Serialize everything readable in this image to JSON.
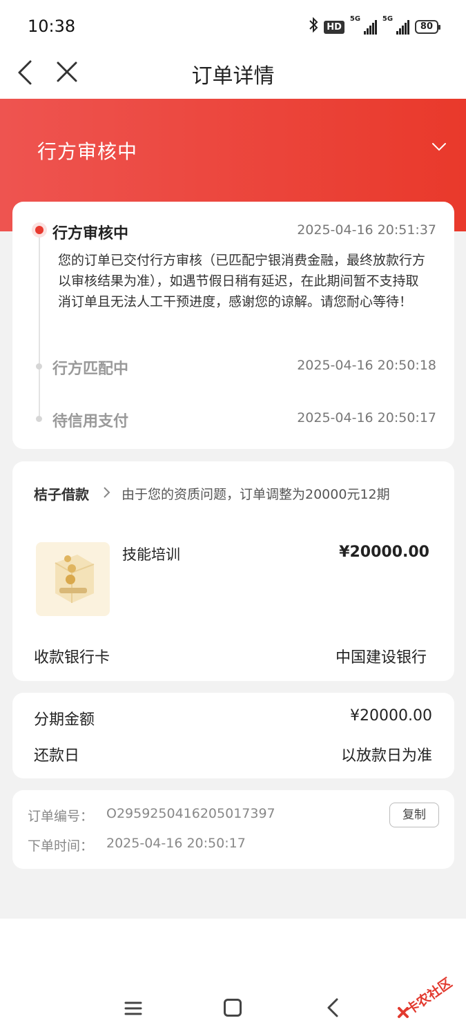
{
  "status_bar": {
    "time": "10:38",
    "hd_label": "HD",
    "signal1_label": "5G",
    "signal2_label": "5G",
    "battery": "80",
    "icons": [
      "bluetooth-icon",
      "hd-voice-icon",
      "signal-icon",
      "signal-icon",
      "battery-icon"
    ]
  },
  "nav": {
    "title": "订单详情",
    "icons": [
      "back-icon",
      "close-icon"
    ]
  },
  "banner": {
    "status": "行方审核中",
    "icon": "chevron-down-icon",
    "colors": [
      "#ee5450",
      "#e9392b"
    ]
  },
  "timeline": [
    {
      "title": "行方审核中",
      "time": "2025-04-16 20:51:37",
      "desc": "您的订单已交付行方审核（已匹配宁银消费金融，最终放款行方以审核结果为准），如遇节假日稍有延迟，在此期间暂不支持取消订单且无法人工干预进度，感谢您的谅解。请您耐心等待！",
      "active": true
    },
    {
      "title": "行方匹配中",
      "time": "2025-04-16 20:50:18",
      "active": false
    },
    {
      "title": "待信用支付",
      "time": "2025-04-16 20:50:17",
      "active": false
    }
  ],
  "order": {
    "merchant": "桔子借款",
    "note": "由于您的资质问题，订单调整为20000元12期",
    "product_name": "技能培训",
    "product_price": "¥20000.00",
    "bank_label": "收款银行卡",
    "bank_value": "中国建设银行"
  },
  "installment": {
    "amount_label": "分期金额",
    "amount_value": "¥20000.00",
    "repay_label": "还款日",
    "repay_value": "以放款日为准"
  },
  "info": {
    "order_no_label": "订单编号：",
    "order_no": "O2959250416205017397",
    "copy_label": "复制",
    "time_label": "下单时间：",
    "time_value": "2025-04-16 20:50:17"
  },
  "system_nav": {
    "icons": [
      "menu-icon",
      "home-icon",
      "back-icon"
    ]
  },
  "watermark": {
    "text": "卡农社区"
  },
  "colors": {
    "accent": "#e83a2f",
    "background": "#f2f2f2"
  }
}
